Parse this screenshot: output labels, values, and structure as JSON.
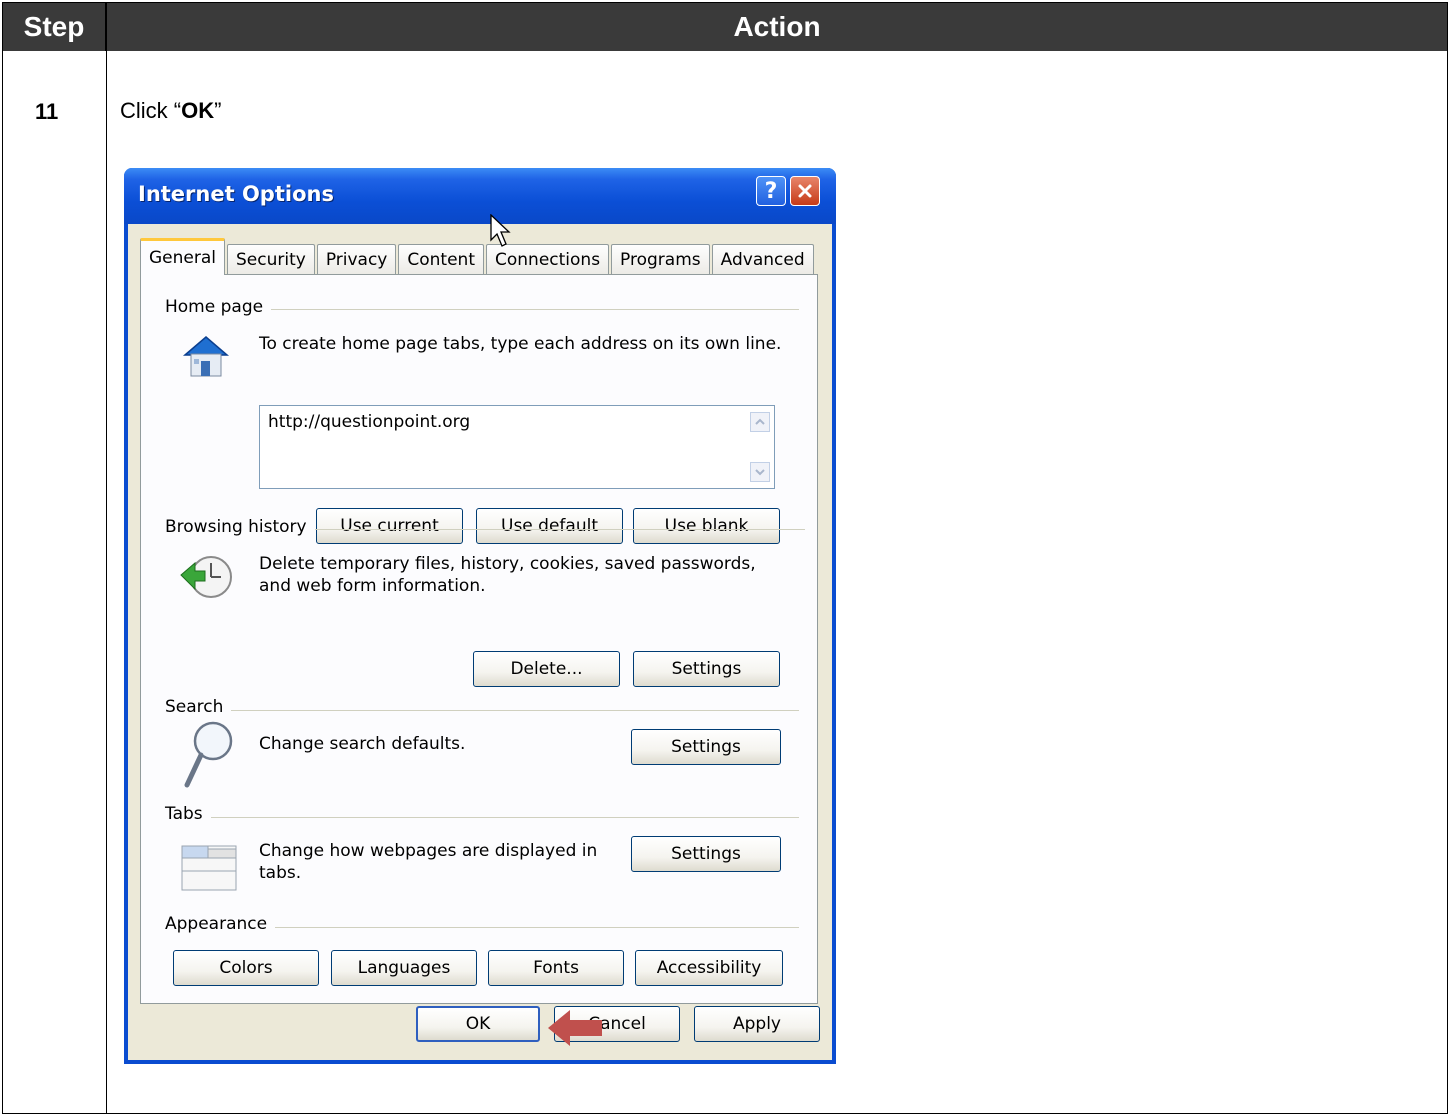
{
  "table": {
    "header_step": "Step",
    "header_action": "Action",
    "step_number": "11",
    "instruction_prefix": "Click “",
    "instruction_bold": "OK",
    "instruction_suffix": "”"
  },
  "dialog": {
    "title": "Internet Options",
    "help_label": "?",
    "tabs": [
      "General",
      "Security",
      "Privacy",
      "Content",
      "Connections",
      "Programs",
      "Advanced"
    ],
    "active_tab": "General",
    "home_page": {
      "label": "Home page",
      "description": "To create home page tabs, type each address on its own line.",
      "value": "http://questionpoint.org",
      "use_current": "Use current",
      "use_default": "Use default",
      "use_blank": "Use blank"
    },
    "browsing_history": {
      "label": "Browsing history",
      "description_line1": "Delete temporary files, history, cookies, saved passwords,",
      "description_line2": "and web form information.",
      "delete_button": "Delete...",
      "settings_button": "Settings"
    },
    "search": {
      "label": "Search",
      "description": "Change search defaults.",
      "settings_button": "Settings"
    },
    "tabs_section": {
      "label": "Tabs",
      "description_line1": "Change how webpages are displayed in",
      "description_line2": "tabs.",
      "settings_button": "Settings"
    },
    "appearance": {
      "label": "Appearance",
      "colors": "Colors",
      "languages": "Languages",
      "fonts": "Fonts",
      "accessibility": "Accessibility"
    },
    "footer": {
      "ok": "OK",
      "cancel": "Cancel",
      "apply": "Apply"
    }
  },
  "colors": {
    "header_bg": "#3a3a3a",
    "titlebar_blue": "#0a4cd0",
    "dialog_face": "#ece9d8",
    "arrow_red": "#c0504d"
  }
}
